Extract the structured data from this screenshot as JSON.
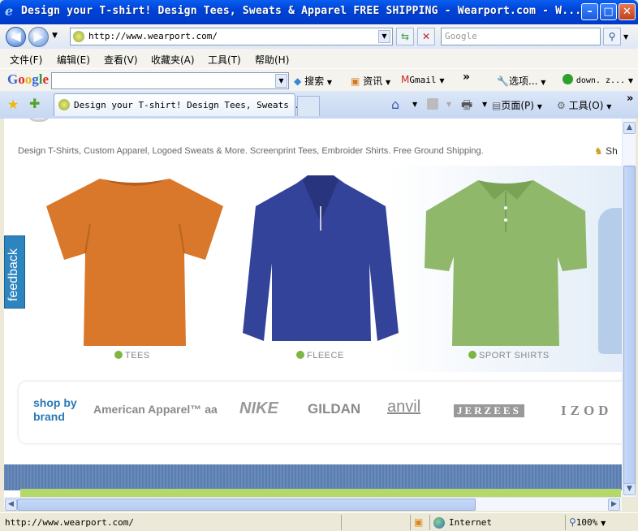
{
  "window": {
    "title": "Design your T-shirt! Design Tees, Design Tees, Sweats & Apparel FREE SHIPPING - Wearport.com - W...",
    "title_display": "Design your T-shirt! Design Tees, Sweats & Apparel FREE SHIPPING - Wearport.com - W...",
    "minimize": "–",
    "maximize": "□",
    "close": "✕"
  },
  "address_bar": {
    "url": "http://www.wearport.com/",
    "search_placeholder": "Google"
  },
  "menu": [
    "文件(F)",
    "编辑(E)",
    "查看(V)",
    "收藏夹(A)",
    "工具(T)",
    "帮助(H)"
  ],
  "google_toolbar": {
    "logo": "Google",
    "search_btn": "搜索",
    "news": "资讯",
    "gmail": "Gmail",
    "more": "»",
    "options": "选项...",
    "down": "down. z..."
  },
  "tabs": {
    "active_label": "Design your T-shirt! Design Tees, Sweats ...",
    "home": "⌂",
    "page_menu": "页面(P)",
    "tools_menu": "工具(O)",
    "more": "»"
  },
  "page": {
    "tagline": "Design T-Shirts, Custom Apparel, Logoed Sweats & More. Screenprint Tees, Embroider Shirts. Free Ground Shipping.",
    "share_partial": "Sh",
    "feedback": "feedback",
    "products": [
      {
        "label": "TEES",
        "color": "#d9772a"
      },
      {
        "label": "FLEECE",
        "color": "#33439a"
      },
      {
        "label": "SPORT SHIRTS",
        "color": "#8fb86a"
      }
    ],
    "brands_heading": "shop by brand",
    "brands": [
      "American Apparel™ aa",
      "NIKE",
      "GILDAN",
      "anvil",
      "JERZEES",
      "IZOD"
    ]
  },
  "status_bar": {
    "url": "http://www.wearport.com/",
    "zone": "Internet",
    "zoom": "100%"
  }
}
